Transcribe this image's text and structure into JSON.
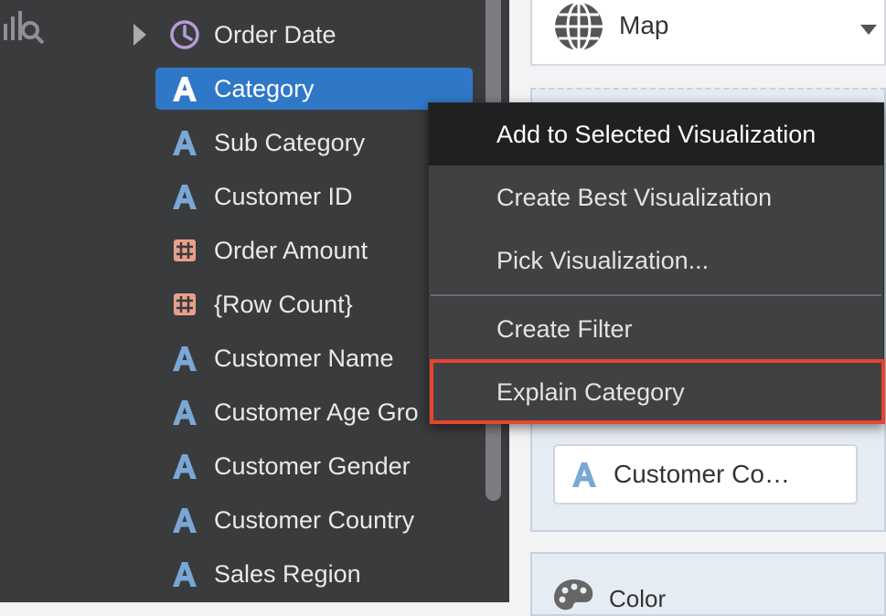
{
  "fields": [
    {
      "label": "Order Date",
      "icon": "clock-icon",
      "selected": false
    },
    {
      "label": "Category",
      "icon": "text-attribute-icon",
      "selected": true
    },
    {
      "label": "Sub Category",
      "icon": "text-attribute-icon",
      "selected": false
    },
    {
      "label": "Customer ID",
      "icon": "text-attribute-icon",
      "selected": false
    },
    {
      "label": "Order Amount",
      "icon": "measure-hash-icon",
      "selected": false
    },
    {
      "label": "{Row Count}",
      "icon": "measure-hash-icon",
      "selected": false
    },
    {
      "label": "Customer Name",
      "icon": "text-attribute-icon",
      "selected": false
    },
    {
      "label": "Customer Age Gro",
      "icon": "text-attribute-icon",
      "selected": false
    },
    {
      "label": "Customer Gender",
      "icon": "text-attribute-icon",
      "selected": false
    },
    {
      "label": "Customer Country",
      "icon": "text-attribute-icon",
      "selected": false
    },
    {
      "label": "Sales Region",
      "icon": "text-attribute-icon",
      "selected": false
    }
  ],
  "visualization": {
    "selected": "Map",
    "icon": "globe-icon"
  },
  "grammar_pill": {
    "label": "Customer Co…",
    "icon": "text-attribute-icon"
  },
  "color_section": {
    "label": "Color",
    "icon": "palette-icon"
  },
  "context_menu": {
    "items": [
      {
        "label": "Add to Selected Visualization",
        "active": true
      },
      {
        "label": "Create Best Visualization",
        "active": false
      },
      {
        "label": "Pick Visualization...",
        "active": false
      },
      {
        "label": "Create Filter",
        "active": false
      },
      {
        "label": "Explain Category",
        "active": false,
        "highlighted": true
      }
    ]
  },
  "colors": {
    "panel_dark": "#3a3b3d",
    "selection_blue": "#2f78c8",
    "attribute_icon": "#7aa7d6",
    "measure_icon": "#e8a08c",
    "highlight_red": "#e8452d"
  }
}
